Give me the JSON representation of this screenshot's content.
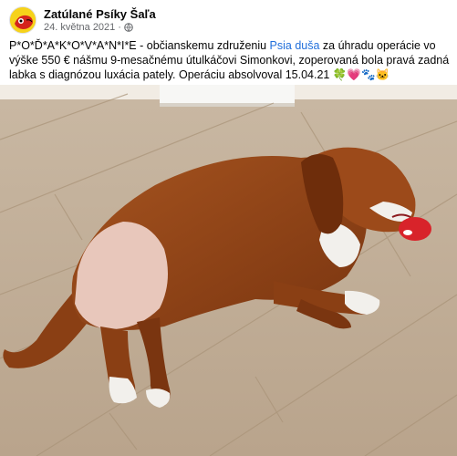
{
  "post": {
    "page_name": "Zatúlané Psíky Šaľa",
    "date": "24. května 2021",
    "separator": "·",
    "text_before_link": "P*O*Ď*A*K*O*V*A*N*I*E - občianskemu združeniu ",
    "link_text": "Psia duša",
    "text_after_link": " za úhradu operácie vo výške 550 € nášmu 9-mesačnému útulkáčovi Simonkovi, zoperovaná bola pravá zadná labka s diagnózou luxácia pately. Operáciu absolvoval 15.04.21 ",
    "emojis": "🍀💗🐾🐱"
  },
  "icons": {
    "audience": "globe-icon",
    "avatar": "page-avatar"
  },
  "colors": {
    "link": "#216fdb",
    "secondary_text": "#65676b",
    "avatar_bg": "#f6d21a"
  }
}
